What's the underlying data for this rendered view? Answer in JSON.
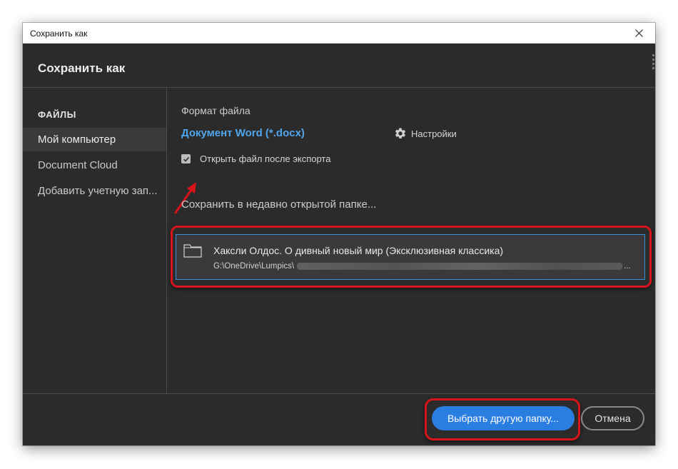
{
  "window": {
    "title": "Сохранить как"
  },
  "dialog": {
    "title": "Сохранить как"
  },
  "sidebar": {
    "header": "ФАЙЛЫ",
    "items": [
      {
        "label": "Мой компьютер",
        "selected": true
      },
      {
        "label": "Document Cloud",
        "selected": false
      },
      {
        "label": "Добавить учетную зап..."
      }
    ]
  },
  "format": {
    "label": "Формат файла",
    "value": "Документ Word (*.docx)",
    "settings_label": "Настройки"
  },
  "open_after_export": {
    "label": "Открыть файл после экспорта",
    "checked": true
  },
  "recent": {
    "label": "Сохранить в недавно открытой папке...",
    "folder_name": "Хаксли Олдос. О дивный новый мир (Эксклюзивная классика)",
    "folder_path": "G:\\OneDrive\\Lumpics\\",
    "folder_path_suffix": "..."
  },
  "buttons": {
    "choose_folder": "Выбрать другую папку...",
    "cancel": "Отмена"
  },
  "icons": {
    "close": "close-icon",
    "gear": "gear-icon",
    "folder": "folder-icon",
    "checkmark": "checkmark-icon"
  },
  "colors": {
    "accent": "#2a7de1",
    "link": "#4fa6ee",
    "highlight": "#d7141a",
    "background": "#2b2b2b"
  }
}
